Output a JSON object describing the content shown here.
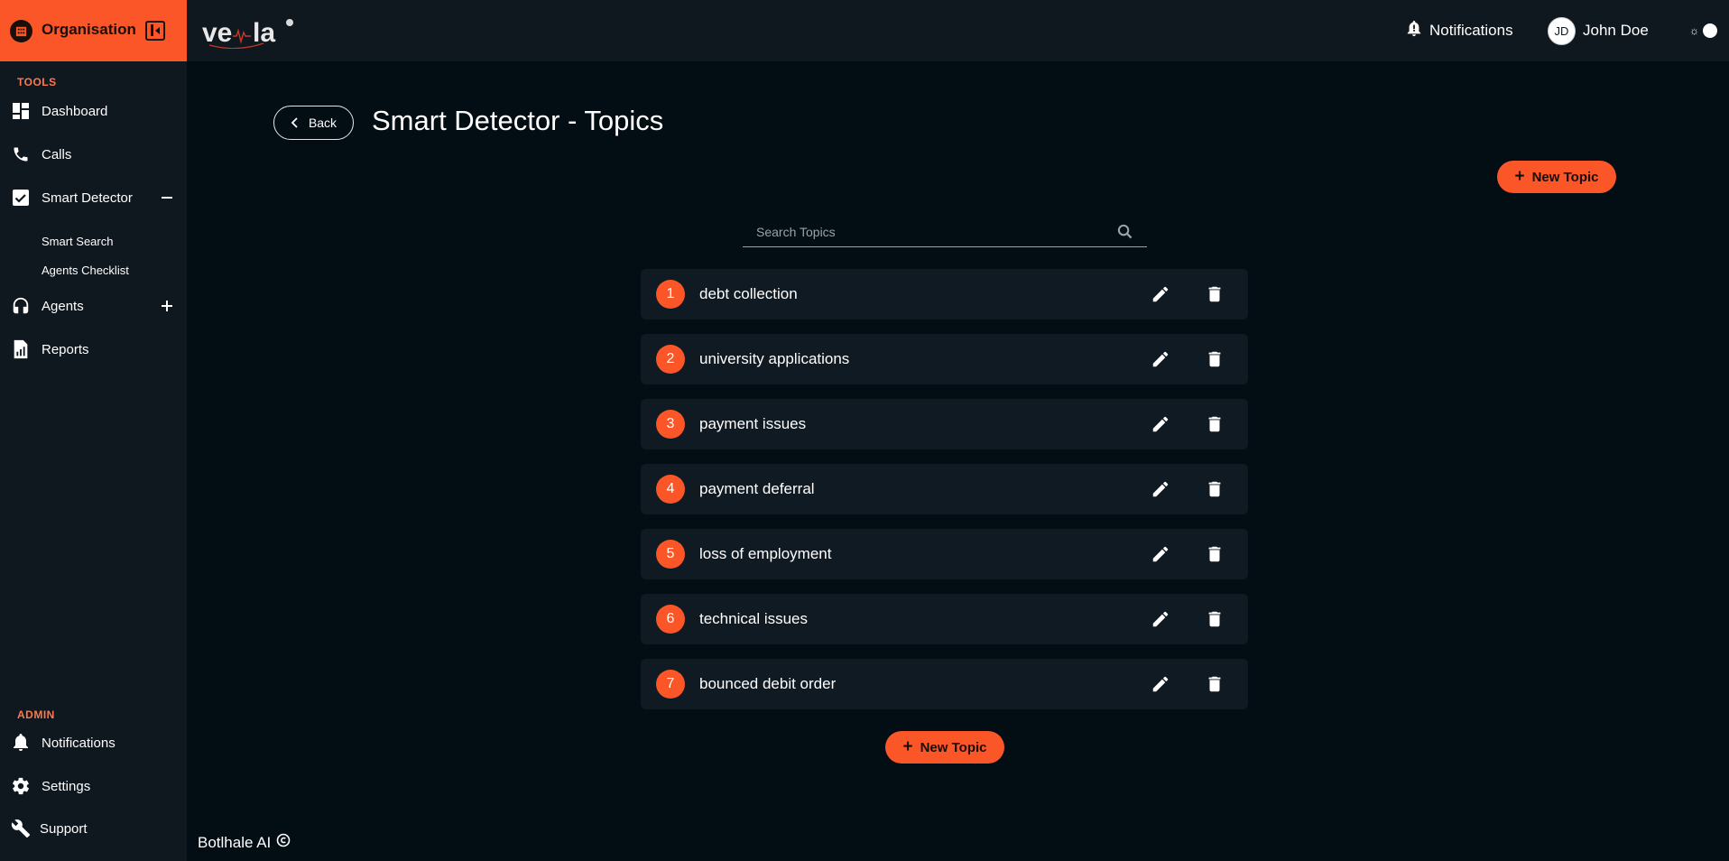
{
  "sidebar": {
    "org_label": "Organisation",
    "tools_section": "TOOLS",
    "admin_section": "ADMIN",
    "items": [
      {
        "label": "Dashboard",
        "icon": "dashboard-icon"
      },
      {
        "label": "Calls",
        "icon": "phone-icon"
      },
      {
        "label": "Smart Detector",
        "icon": "checkbox-icon",
        "toggle": "collapse"
      },
      {
        "label": "Agents",
        "icon": "headset-icon",
        "toggle": "expand"
      },
      {
        "label": "Reports",
        "icon": "report-icon"
      }
    ],
    "sub_items": [
      {
        "label": "Smart Search"
      },
      {
        "label": "Agents Checklist"
      }
    ],
    "admin_items": [
      {
        "label": "Notifications",
        "icon": "bell-icon"
      },
      {
        "label": "Settings",
        "icon": "gear-icon"
      },
      {
        "label": "Support",
        "icon": "wrench-icon"
      }
    ]
  },
  "topbar": {
    "logo_text": "ve  la",
    "notifications_label": "Notifications",
    "user_initials": "JD",
    "user_name": "John Doe"
  },
  "main": {
    "back_label": "Back",
    "title": "Smart Detector - Topics",
    "new_topic_label": "New Topic",
    "search_placeholder": "Search Topics",
    "search_value": "",
    "topics": [
      {
        "number": "1",
        "label": "debt collection"
      },
      {
        "number": "2",
        "label": "university applications"
      },
      {
        "number": "3",
        "label": "payment issues"
      },
      {
        "number": "4",
        "label": "payment deferral"
      },
      {
        "number": "5",
        "label": "loss of employment"
      },
      {
        "number": "6",
        "label": "technical issues"
      },
      {
        "number": "7",
        "label": "bounced debit order"
      }
    ]
  },
  "footer": {
    "text": "Botlhale AI"
  },
  "colors": {
    "accent": "#fa5628",
    "background": "#030d14",
    "panel": "#0f171f",
    "row": "#101a23"
  }
}
